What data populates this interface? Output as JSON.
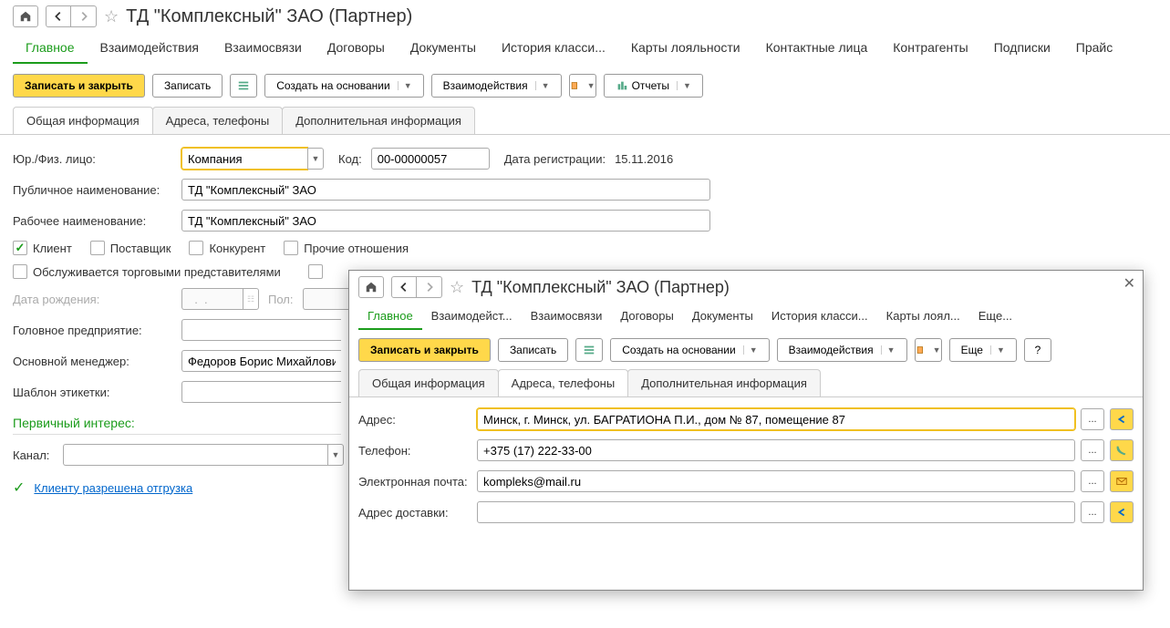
{
  "main": {
    "title": "ТД \"Комплексный\" ЗАО (Партнер)",
    "nav_tabs": [
      "Главное",
      "Взаимодействия",
      "Взаимосвязи",
      "Договоры",
      "Документы",
      "История класси...",
      "Карты лояльности",
      "Контактные лица",
      "Контрагенты",
      "Подписки",
      "Прайс"
    ],
    "active_tab": 0,
    "toolbar": {
      "save_close": "Записать и закрыть",
      "save": "Записать",
      "create_based": "Создать на основании",
      "interactions": "Взаимодействия",
      "reports": "Отчеты"
    },
    "sub_tabs": [
      "Общая информация",
      "Адреса, телефоны",
      "Дополнительная информация"
    ],
    "active_sub_tab": 0,
    "form": {
      "entity_type_label": "Юр./Физ. лицо:",
      "entity_type_value": "Компания",
      "code_label": "Код:",
      "code_value": "00-00000057",
      "reg_date_label": "Дата регистрации:",
      "reg_date_value": "15.11.2016",
      "public_name_label": "Публичное наименование:",
      "public_name_value": "ТД \"Комплексный\" ЗАО",
      "work_name_label": "Рабочее наименование:",
      "work_name_value": "ТД \"Комплексный\" ЗАО",
      "checkboxes": {
        "client": "Клиент",
        "supplier": "Поставщик",
        "competitor": "Конкурент",
        "other": "Прочие отношения"
      },
      "serviced_label": "Обслуживается торговыми представителями",
      "birth_label": "Дата рождения:",
      "birth_value": "  .  .    ",
      "sex_label": "Пол:",
      "head_ent_label": "Головное предприятие:",
      "manager_label": "Основной менеджер:",
      "manager_value": "Федоров Борис Михайлович",
      "template_label": "Шаблон этикетки:",
      "interest_header": "Первичный интерес:",
      "channel_label": "Канал:",
      "status_text": "Клиенту разрешена отгрузка"
    }
  },
  "modal": {
    "title": "ТД \"Комплексный\" ЗАО (Партнер)",
    "nav_tabs": [
      "Главное",
      "Взаимодейст...",
      "Взаимосвязи",
      "Договоры",
      "Документы",
      "История класси...",
      "Карты лоял...",
      "Еще..."
    ],
    "active_tab": 0,
    "toolbar": {
      "save_close": "Записать и закрыть",
      "save": "Записать",
      "create_based": "Создать на основании",
      "interactions": "Взаимодействия",
      "more": "Еще",
      "help": "?"
    },
    "sub_tabs": [
      "Общая информация",
      "Адреса, телефоны",
      "Дополнительная информация"
    ],
    "active_sub_tab": 1,
    "form": {
      "address_label": "Адрес:",
      "address_value": "Минск, г. Минск, ул. БАГРАТИОНА П.И., дом № 87, помещение 87",
      "phone_label": "Телефон:",
      "phone_value": "+375 (17) 222-33-00",
      "email_label": "Электронная почта:",
      "email_value": "kompleks@mail.ru",
      "delivery_label": "Адрес доставки:",
      "delivery_value": ""
    }
  }
}
